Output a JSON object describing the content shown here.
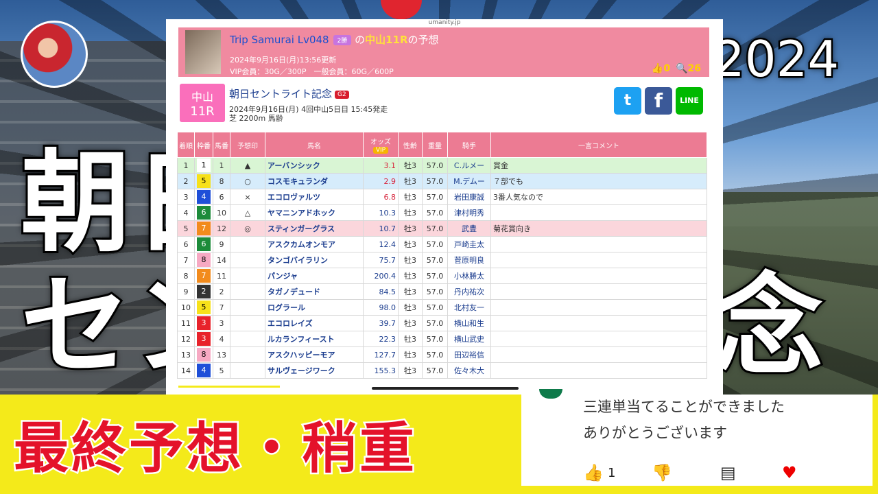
{
  "background": {
    "big_title_line1": "朝日",
    "big_title_line2": "セン",
    "big_title_line2_right": "念",
    "year": "2024"
  },
  "banner": {
    "text": "最終予想・稍重"
  },
  "comment": {
    "line1": "三連単当てることができました",
    "line2": "ありがとうございます",
    "likes": "1",
    "like_icon": "thumbs-up-icon",
    "dislike_icon": "thumbs-down-icon",
    "reply_icon": "comment-icon",
    "heart_icon": "heart-icon"
  },
  "panel": {
    "url": "umanity.jp",
    "predictor": {
      "name": "Trip Samurai Lv048",
      "badge": "2勝",
      "of": "の",
      "race_ref": "中山11R",
      "suffix": "の予想",
      "updated": "2024年9月16日(月)13:56更新",
      "price": "VIP会員：30G／300P　一般会員：60G／600P",
      "thumbs": "👍0",
      "views": "🔍26"
    },
    "race": {
      "venue": "中山",
      "num": "11R",
      "title": "朝日セントライト記念",
      "grade": "G2",
      "meta": "2024年9月16日(月) 4回中山5日目 15:45発走",
      "course": "芝 2200m 馬齢"
    },
    "social": {
      "twitter": "t",
      "facebook": "f",
      "line": "LINE"
    },
    "table": {
      "headers": [
        "着順",
        "枠番",
        "馬番",
        "予想印",
        "馬名",
        "オッズ",
        "性齢",
        "重量",
        "騎手",
        "一言コメント"
      ],
      "vip": "VIP",
      "rows": [
        {
          "rank": "1",
          "waku": "1",
          "ban": "1",
          "mark": "▲",
          "horse": "アーバンシック",
          "odds": "3.1",
          "sex": "牡3",
          "wt": "57.0",
          "jockey": "C.ルメー",
          "comment": "賞金",
          "cls": "row-green",
          "hot": true
        },
        {
          "rank": "2",
          "waku": "5",
          "ban": "8",
          "mark": "○",
          "horse": "コスモキュランダ",
          "odds": "2.9",
          "sex": "牡3",
          "wt": "57.0",
          "jockey": "M.デムー",
          "comment": "７部でも",
          "cls": "row-blue",
          "hot": true
        },
        {
          "rank": "3",
          "waku": "4",
          "ban": "6",
          "mark": "×",
          "horse": "エコロヴァルツ",
          "odds": "6.8",
          "sex": "牡3",
          "wt": "57.0",
          "jockey": "岩田康誠",
          "comment": "3番人気なので",
          "cls": "",
          "hot": true
        },
        {
          "rank": "4",
          "waku": "6",
          "ban": "10",
          "mark": "△",
          "horse": "ヤマニンアドホック",
          "odds": "10.3",
          "sex": "牡3",
          "wt": "57.0",
          "jockey": "津村明秀",
          "comment": "",
          "cls": "",
          "hot": false
        },
        {
          "rank": "5",
          "waku": "7",
          "ban": "12",
          "mark": "◎",
          "horse": "スティンガーグラス",
          "odds": "10.7",
          "sex": "牡3",
          "wt": "57.0",
          "jockey": "武豊",
          "comment": "菊花賞向き",
          "cls": "row-pink",
          "hot": false
        },
        {
          "rank": "6",
          "waku": "6",
          "ban": "9",
          "mark": "",
          "horse": "アスクカムオンモア",
          "odds": "12.4",
          "sex": "牡3",
          "wt": "57.0",
          "jockey": "戸崎圭太",
          "comment": "",
          "cls": "",
          "hot": false
        },
        {
          "rank": "7",
          "waku": "8",
          "ban": "14",
          "mark": "",
          "horse": "タンゴバイラリン",
          "odds": "75.7",
          "sex": "牡3",
          "wt": "57.0",
          "jockey": "菅原明良",
          "comment": "",
          "cls": "",
          "hot": false
        },
        {
          "rank": "8",
          "waku": "7",
          "ban": "11",
          "mark": "",
          "horse": "パンジャ",
          "odds": "200.4",
          "sex": "牡3",
          "wt": "57.0",
          "jockey": "小林勝太",
          "comment": "",
          "cls": "",
          "hot": false
        },
        {
          "rank": "9",
          "waku": "2",
          "ban": "2",
          "mark": "",
          "horse": "タガノデュード",
          "odds": "84.5",
          "sex": "牡3",
          "wt": "57.0",
          "jockey": "丹内祐次",
          "comment": "",
          "cls": "",
          "hot": false
        },
        {
          "rank": "10",
          "waku": "5",
          "ban": "7",
          "mark": "",
          "horse": "ログラール",
          "odds": "98.0",
          "sex": "牡3",
          "wt": "57.0",
          "jockey": "北村友一",
          "comment": "",
          "cls": "",
          "hot": false
        },
        {
          "rank": "11",
          "waku": "3",
          "ban": "3",
          "mark": "",
          "horse": "エコロレイズ",
          "odds": "39.7",
          "sex": "牡3",
          "wt": "57.0",
          "jockey": "横山和生",
          "comment": "",
          "cls": "",
          "hot": false
        },
        {
          "rank": "12",
          "waku": "3",
          "ban": "4",
          "mark": "",
          "horse": "ルカランフィースト",
          "odds": "22.3",
          "sex": "牡3",
          "wt": "57.0",
          "jockey": "横山武史",
          "comment": "",
          "cls": "",
          "hot": false
        },
        {
          "rank": "13",
          "waku": "8",
          "ban": "13",
          "mark": "",
          "horse": "アスクハッピーモア",
          "odds": "127.7",
          "sex": "牡3",
          "wt": "57.0",
          "jockey": "田辺裕信",
          "comment": "",
          "cls": "",
          "hot": false
        },
        {
          "rank": "14",
          "waku": "4",
          "ban": "5",
          "mark": "",
          "horse": "サルヴェージワーク",
          "odds": "155.3",
          "sex": "牡3",
          "wt": "57.0",
          "jockey": "佐々木大",
          "comment": "",
          "cls": "",
          "hot": false
        }
      ]
    },
    "waku_colors": {
      "1": [
        "#ffffff",
        "#000"
      ],
      "2": [
        "#333333",
        "#fff"
      ],
      "3": [
        "#e8222b",
        "#fff"
      ],
      "4": [
        "#1f4fd8",
        "#fff"
      ],
      "5": [
        "#f7e11a",
        "#000"
      ],
      "6": [
        "#1d8b3a",
        "#fff"
      ],
      "7": [
        "#f28b1d",
        "#fff"
      ],
      "8": [
        "#f7a9c3",
        "#000"
      ]
    }
  }
}
